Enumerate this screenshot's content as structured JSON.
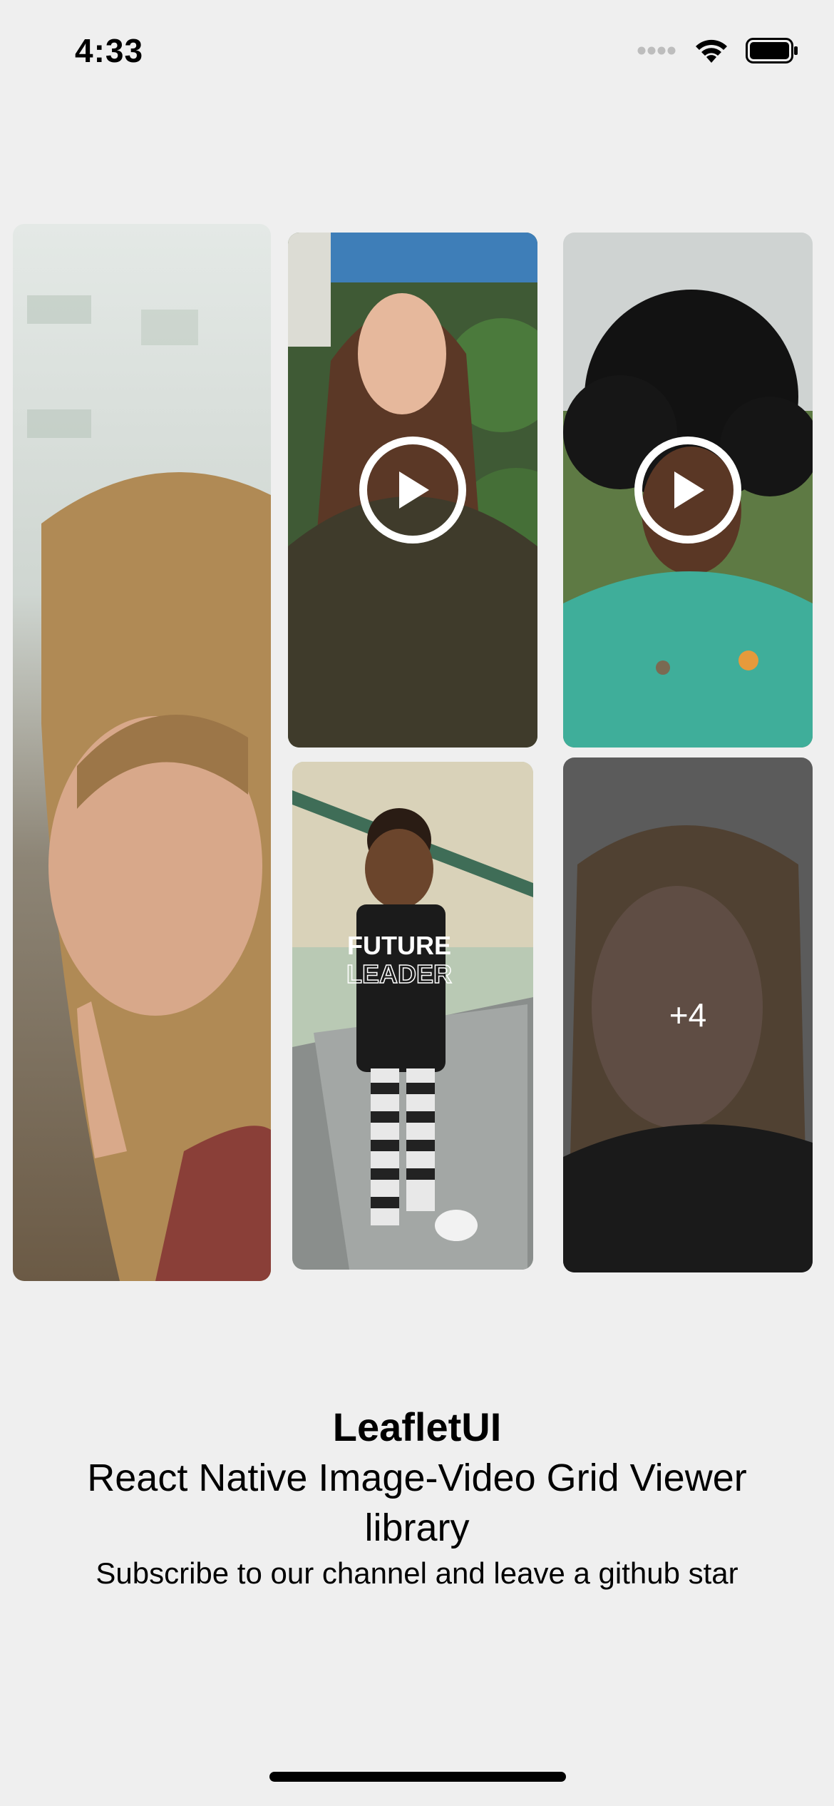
{
  "status_bar": {
    "time": "4:33",
    "signal_icon": "cellular-dots-icon",
    "wifi_icon": "wifi-icon",
    "battery_icon": "battery-icon"
  },
  "grid": {
    "tiles": [
      {
        "kind": "image",
        "subject": "woman-smiling-finger-on-lip"
      },
      {
        "kind": "video",
        "subject": "woman-olive-top-garden",
        "overlay_icon": "play-icon"
      },
      {
        "kind": "video",
        "subject": "woman-curly-hair-green-top",
        "overlay_icon": "play-icon"
      },
      {
        "kind": "image",
        "subject": "child-future-leader-shirt",
        "shirt_text_1": "FUTURE",
        "shirt_text_2": "LEADER"
      },
      {
        "kind": "image",
        "subject": "woman-smiling-dark-top",
        "more_label": "+4"
      }
    ]
  },
  "footer": {
    "title": "LeafletUI",
    "subtitle": "React Native Image-Video Grid Viewer library",
    "caption": "Subscribe to our channel and leave a github star"
  },
  "colors": {
    "background": "#efefef",
    "overlay": "rgba(30,30,30,0.62)",
    "text": "#000000"
  }
}
